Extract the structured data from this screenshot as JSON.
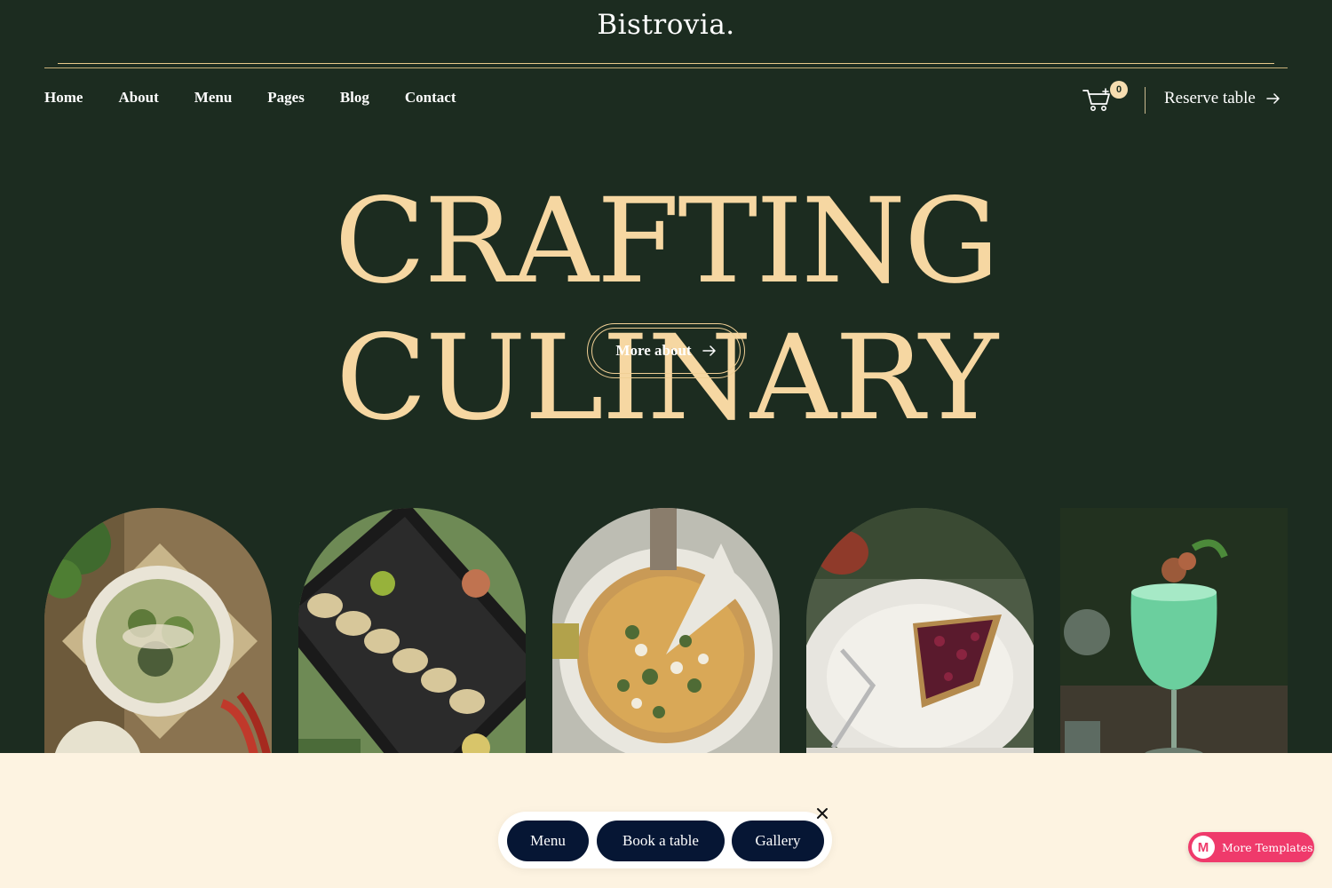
{
  "brand": {
    "logo_text": "Bistrovia."
  },
  "nav": {
    "items": [
      "Home",
      "About",
      "Menu",
      "Pages",
      "Blog",
      "Contact"
    ]
  },
  "cart": {
    "count": "0",
    "icon": "cart-icon"
  },
  "reserve": {
    "label": "Reserve table",
    "icon": "arrow-right-icon"
  },
  "hero": {
    "title": "CRAFTING CULINARY",
    "button_label": "More about",
    "button_icon": "arrow-right-icon"
  },
  "gallery": {
    "images": [
      "salad-image",
      "sushi-image",
      "pizza-image",
      "tart-image",
      "cocktail-image"
    ]
  },
  "quick_bar": {
    "buttons": [
      "Menu",
      "Book a table",
      "Gallery"
    ],
    "close_icon": "close-icon"
  },
  "promo": {
    "logo_letter": "M",
    "label": "More Templates"
  },
  "colors": {
    "background": "#1c2c20",
    "accent": "#f6d7a2",
    "pill": "#061634",
    "band": "#fdf3e1",
    "promo": "#ef3a6b"
  }
}
